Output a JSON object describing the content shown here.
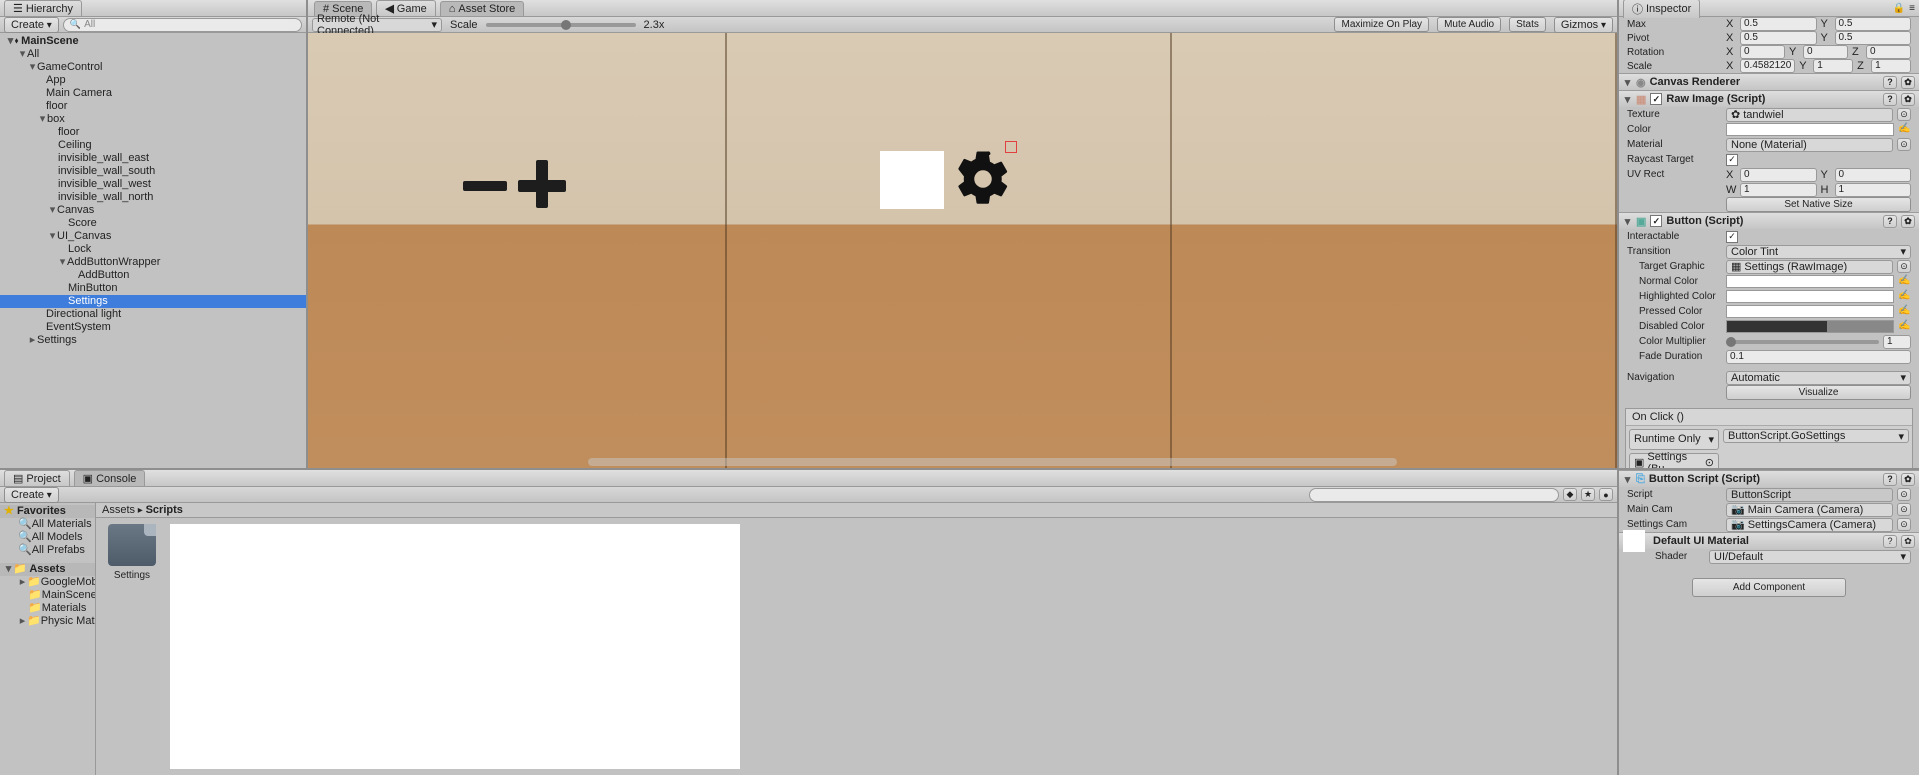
{
  "hierarchy": {
    "tab": "Hierarchy",
    "create": "Create",
    "search_ph": "All",
    "root": "MainScene",
    "items": [
      "All",
      "GameControl",
      "App",
      "Main Camera",
      "floor",
      "box",
      "floor",
      "Ceiling",
      "invisible_wall_east",
      "invisible_wall_south",
      "invisible_wall_west",
      "invisible_wall_north",
      "Canvas",
      "Score",
      "UI_Canvas",
      "Lock",
      "AddButtonWrapper",
      "AddButton",
      "MinButton",
      "Settings",
      "Directional light",
      "EventSystem",
      "Settings"
    ]
  },
  "center": {
    "tabs": [
      "Scene",
      "Game",
      "Asset Store"
    ],
    "aspect": "Remote (Not Connected)",
    "scale_lbl": "Scale",
    "scale_val": "2.3x",
    "right_btns": [
      "Maximize On Play",
      "Mute Audio",
      "Stats",
      "Gizmos"
    ]
  },
  "project": {
    "tabs": [
      "Project",
      "Console"
    ],
    "create": "Create",
    "favorites": "Favorites",
    "fav_items": [
      "All Materials",
      "All Models",
      "All Prefabs"
    ],
    "assets": "Assets",
    "asset_items": [
      "GoogleMobi",
      "MainScene",
      "Materials",
      "Physic Mate"
    ],
    "breadcrumb": [
      "Assets",
      "Scripts"
    ],
    "file": "Settings"
  },
  "inspector": {
    "tab": "Inspector",
    "transform": {
      "max": "Max",
      "pivot": "Pivot",
      "rotation": "Rotation",
      "scale": "Scale",
      "max_x": "0.5",
      "max_y": "0.5",
      "pivot_x": "0.5",
      "pivot_y": "0.5",
      "rot_x": "0",
      "rot_y": "0",
      "rot_z": "0",
      "scale_x": "0.4582120",
      "scale_y": "1",
      "scale_z": "1"
    },
    "canvas_renderer": "Canvas Renderer",
    "rawimage": {
      "title": "Raw Image (Script)",
      "texture": "Texture",
      "texture_val": "tandwiel",
      "color": "Color",
      "material": "Material",
      "material_val": "None (Material)",
      "raycast": "Raycast Target",
      "uvrect": "UV Rect",
      "uv_x": "0",
      "uv_y": "0",
      "uv_w": "1",
      "uv_h": "1",
      "native": "Set Native Size"
    },
    "button": {
      "title": "Button (Script)",
      "interactable": "Interactable",
      "transition": "Transition",
      "transition_val": "Color Tint",
      "target": "Target Graphic",
      "target_val": "Settings (RawImage)",
      "normal": "Normal Color",
      "highlighted": "Highlighted Color",
      "pressed": "Pressed Color",
      "disabled": "Disabled Color",
      "mult": "Color Multiplier",
      "mult_val": "1",
      "fade": "Fade Duration",
      "fade_val": "0.1",
      "nav": "Navigation",
      "nav_val": "Automatic",
      "visualize": "Visualize",
      "onclick": "On Click ()",
      "runtime": "Runtime Only",
      "func": "ButtonScript.GoSettings",
      "onclick_obj": "Settings (Bu"
    },
    "script": {
      "title": "Button Script (Script)",
      "script": "Script",
      "script_val": "ButtonScript",
      "maincam": "Main Cam",
      "maincam_val": "Main Camera (Camera)",
      "setcam": "Settings Cam",
      "setcam_val": "SettingsCamera (Camera)"
    },
    "material": {
      "title": "Default UI Material",
      "shader": "Shader",
      "shader_val": "UI/Default"
    },
    "add": "Add Component"
  }
}
